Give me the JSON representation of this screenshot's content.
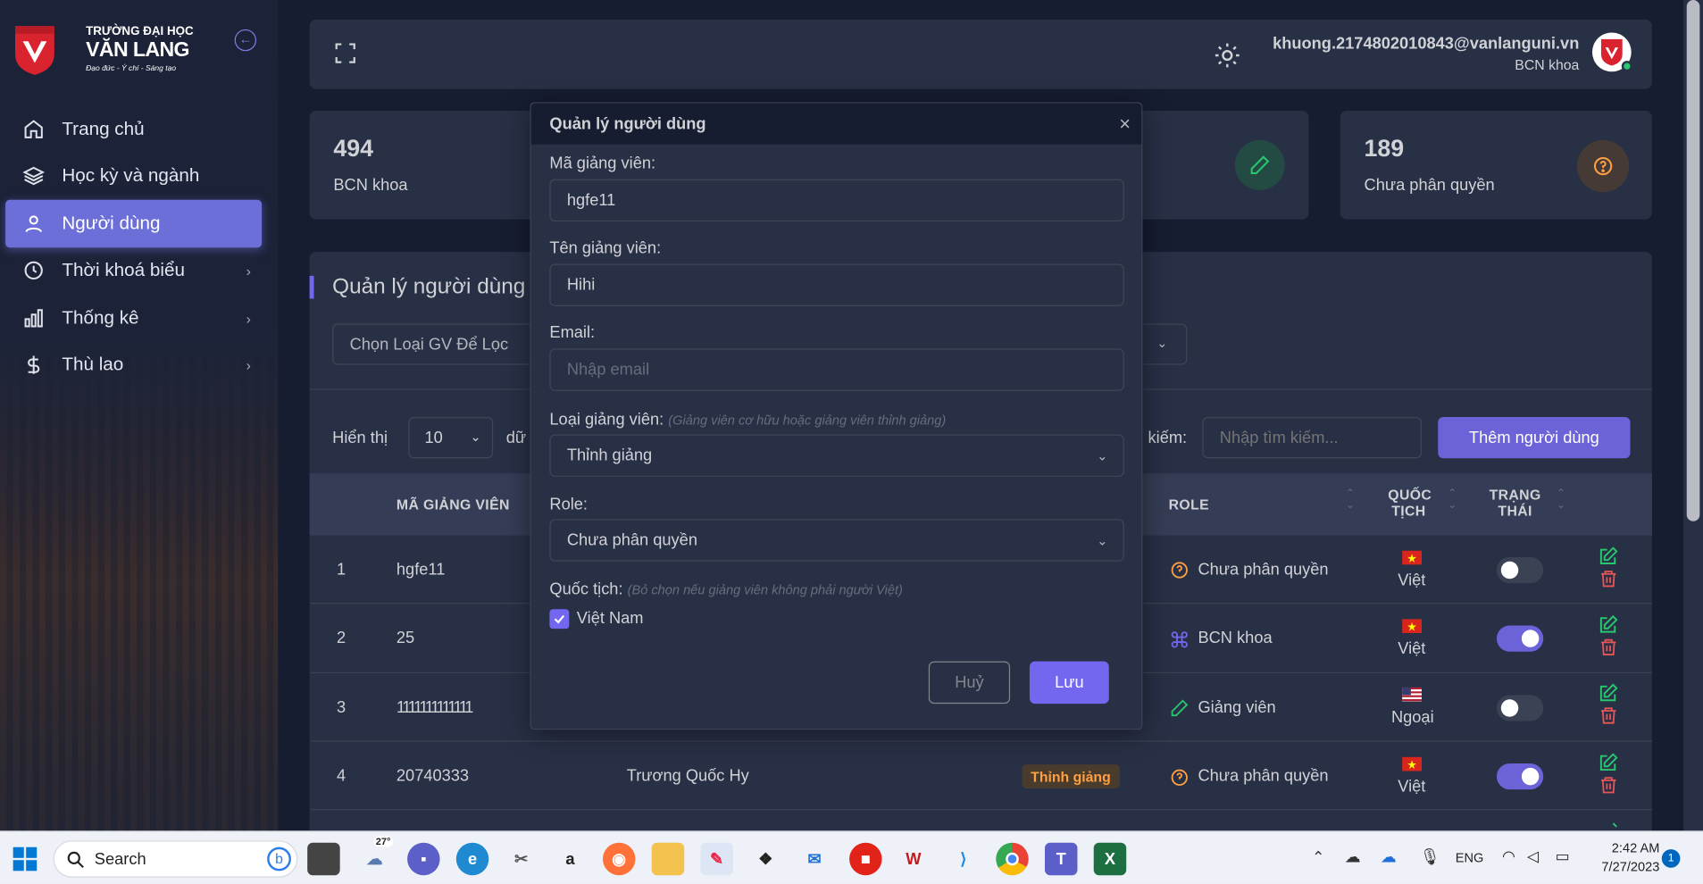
{
  "brand": {
    "line1": "TRƯỜNG ĐẠI HỌC",
    "line2": "VĂN LANG",
    "line3": "Đạo đức - Ý chí - Sáng tạo"
  },
  "sidebar": {
    "items": [
      {
        "label": "Trang chủ",
        "icon": "home-icon"
      },
      {
        "label": "Học kỳ và ngành",
        "icon": "layers-icon"
      },
      {
        "label": "Người dùng",
        "icon": "user-icon",
        "active": true
      },
      {
        "label": "Thời khoá biểu",
        "icon": "clock-icon",
        "chevron": "›"
      },
      {
        "label": "Thống kê",
        "icon": "bar-chart-icon",
        "chevron": "›"
      },
      {
        "label": "Thù lao",
        "icon": "dollar-icon",
        "chevron": "›"
      }
    ]
  },
  "header": {
    "email": "khuong.2174802010843@vanlanguni.vn",
    "role": "BCN khoa"
  },
  "stats": [
    {
      "value": "494",
      "label": "BCN khoa"
    },
    {
      "value": "189",
      "label": "Chưa phân quyền"
    }
  ],
  "main": {
    "title": "Quản lý người dùng",
    "filter_placeholder": "Chọn Loại GV Để Lọc",
    "show_label": "Hiển thị",
    "page_size": "10",
    "show_suffix": "dữ",
    "search_label": "kiếm:",
    "search_placeholder": "Nhập tìm kiếm...",
    "add_button": "Thêm người dùng",
    "columns": {
      "code": "MÃ GIẢNG VIÊN",
      "role": "ROLE",
      "nation1": "QUỐC",
      "nation2": "TỊCH",
      "status1": "TRẠNG",
      "status2": "THÁI"
    },
    "rows": [
      {
        "no": "1",
        "code": "hgfe11",
        "name": "",
        "type": "",
        "role": "Chưa phân quyền",
        "role_icon": "question-circle-icon",
        "nation": "Việt",
        "active": false
      },
      {
        "no": "2",
        "code": "25",
        "name": "",
        "type": "",
        "role": "BCN khoa",
        "role_icon": "command-icon",
        "nation": "Việt",
        "active": true
      },
      {
        "no": "3",
        "code": "1111111111111",
        "name": "",
        "type": "",
        "role": "Giảng viên",
        "role_icon": "pencil-icon",
        "nation": "Ngoại",
        "active": false
      },
      {
        "no": "4",
        "code": "20740333",
        "name": "Trương Quốc Hy",
        "type": "Thỉnh giảng",
        "role": "Chưa phân quyền",
        "role_icon": "question-circle-icon",
        "nation": "Việt",
        "active": true
      }
    ]
  },
  "modal": {
    "title": "Quản lý người dùng",
    "code_label": "Mã giảng viên:",
    "code_value": "hgfe11",
    "name_label": "Tên giảng viên:",
    "name_value": "Hihi",
    "email_label": "Email:",
    "email_placeholder": "Nhập email",
    "type_label": "Loại giảng viên:",
    "type_hint": "(Giảng viên cơ hữu hoặc giảng viên thỉnh giảng)",
    "type_value": "Thỉnh giảng",
    "role_label": "Role:",
    "role_value": "Chưa phân quyền",
    "nation_label": "Quốc tịch:",
    "nation_hint": "(Bỏ chọn nếu giảng viên không phải người Việt)",
    "nation_checkbox": "Việt Nam",
    "nation_checked": true,
    "cancel": "Huỷ",
    "save": "Lưu"
  },
  "taskbar": {
    "search": "Search",
    "weather": "27°",
    "lang": "ENG",
    "time": "2:42 AM",
    "date": "7/27/2023",
    "notifications": "1"
  },
  "colors": {
    "accent": "#7367f0",
    "bg": "#161d31",
    "card": "#283046",
    "success": "#28c76f",
    "danger": "#ea5455",
    "warning": "#ff9f43"
  }
}
